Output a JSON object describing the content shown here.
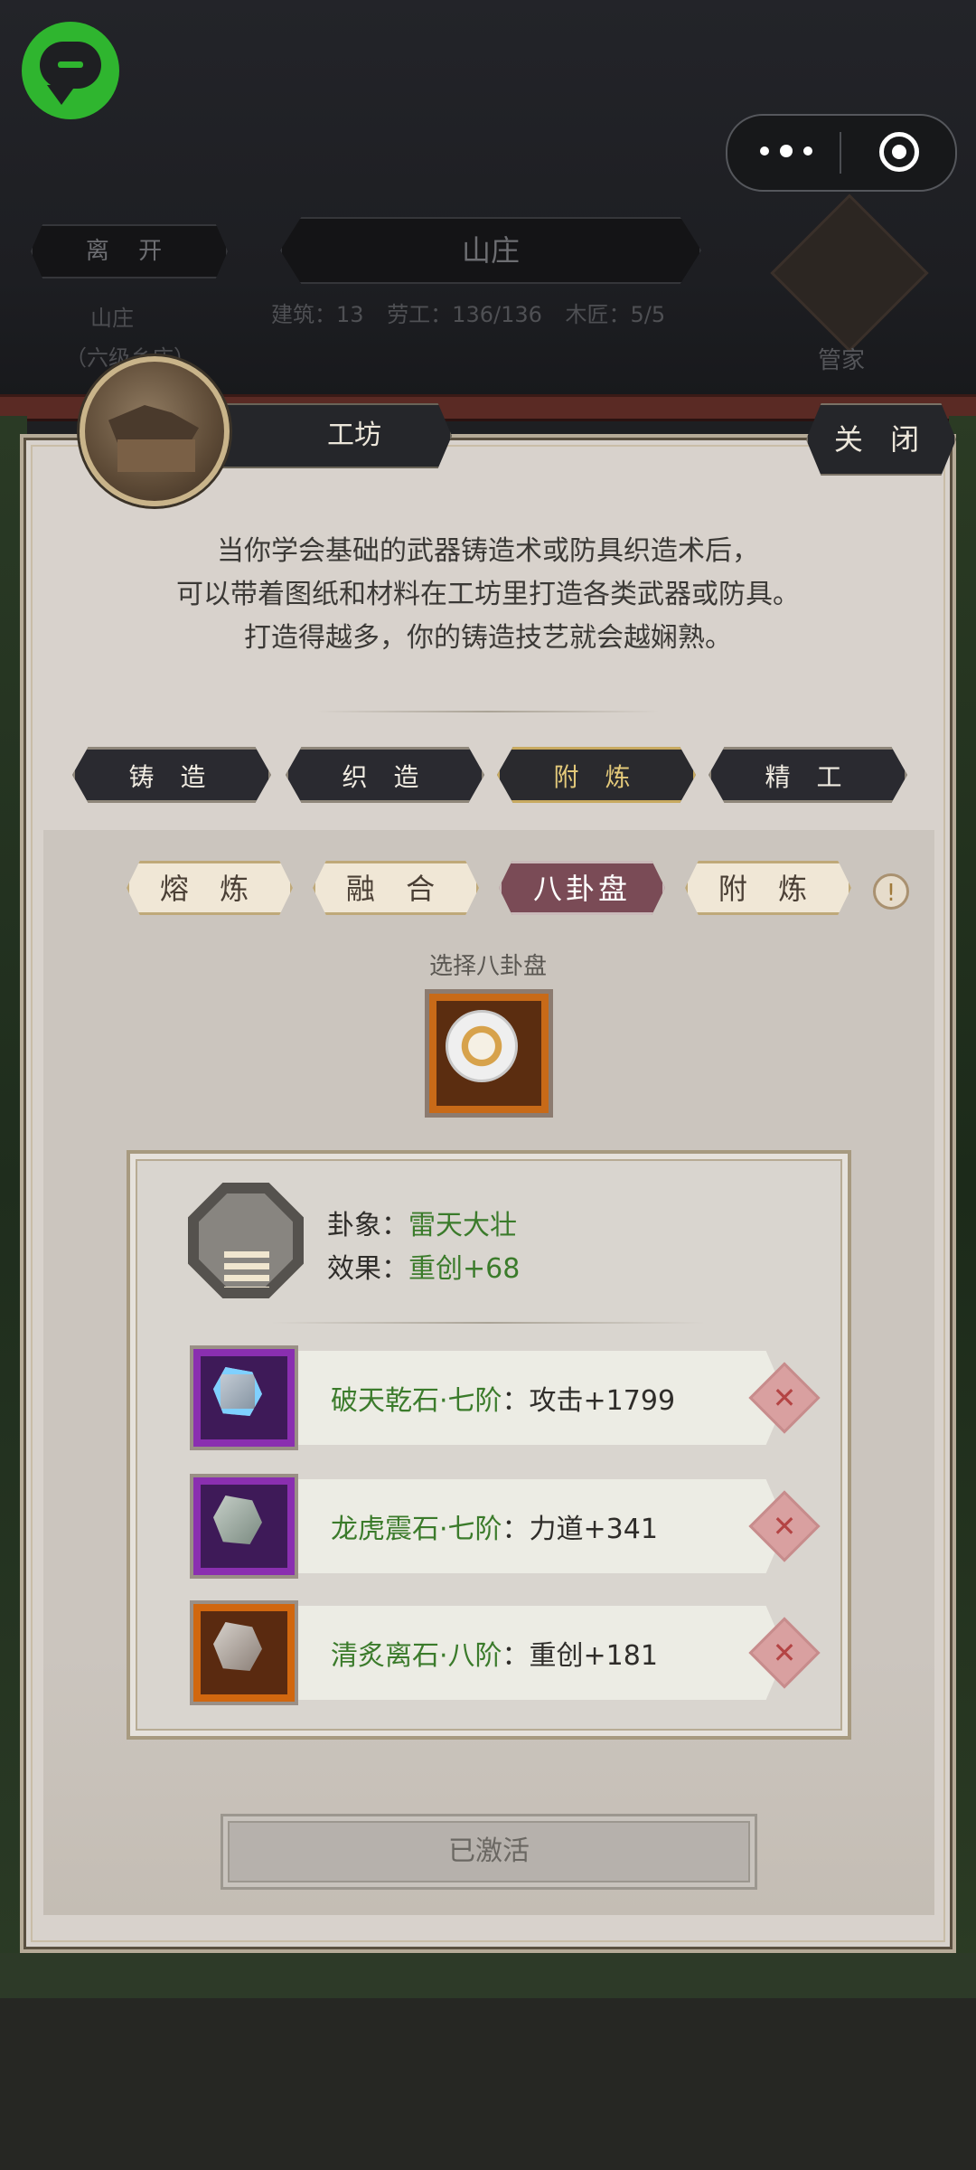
{
  "hud": {
    "leave_label": "离 开",
    "location_title": "山庄",
    "stats": {
      "buildings": "建筑：13",
      "workers": "劳工：136/136",
      "carpenters": "木匠：5/5"
    },
    "left_label_1": "山庄",
    "left_label_2": "（六级乡庄）",
    "steward_label": "管家"
  },
  "panel": {
    "title": "工坊",
    "close_label": "关 闭",
    "intro_lines": [
      "当你学会基础的武器铸造术或防具织造术后，",
      "可以带着图纸和材料在工坊里打造各类武器或防具。",
      "打造得越多，你的铸造技艺就会越娴熟。"
    ],
    "craft_tabs": [
      "铸 造",
      "织 造",
      "附 炼",
      "精 工"
    ],
    "craft_active_index": 2,
    "sub_tabs": [
      "熔 炼",
      "融 合",
      "八卦盘",
      "附 炼"
    ],
    "sub_active_index": 2,
    "info_glyph": "!",
    "select_label": "选择八卦盘",
    "effect": {
      "hexagram_label": "卦象：",
      "hexagram_value": "雷天大壮",
      "effect_label": "效果：",
      "effect_value": "重创+68"
    },
    "stones": [
      {
        "name": "破天乾石·七阶",
        "stat": "：攻击+1799",
        "rarity": "purple"
      },
      {
        "name": "龙虎震石·七阶",
        "stat": "：力道+341",
        "rarity": "purple"
      },
      {
        "name": "清炙离石·八阶",
        "stat": "：重创+181",
        "rarity": "orange"
      }
    ],
    "remove_glyph": "✕",
    "activated_label": "已激活"
  },
  "colors": {
    "accent_green": "#3b7b2b",
    "active_subtab": "#7a4b56",
    "panel_bg": "#d8d2cc"
  }
}
